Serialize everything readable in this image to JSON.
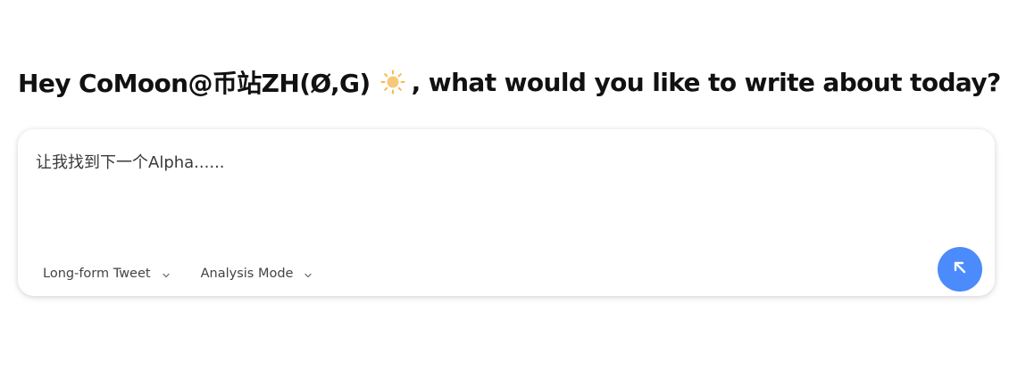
{
  "greeting": {
    "prefix": "Hey CoMoon@币站ZH(Ø,G)",
    "emoji_icon": "sun-icon",
    "suffix": ", what would you like to write about today?"
  },
  "composer": {
    "placeholder": "让我找到下一个Alpha......",
    "format_select": "Long-form Tweet",
    "mode_select": "Analysis Mode",
    "send_icon": "arrow-up-left-icon"
  },
  "colors": {
    "accent": "#4b8bfb",
    "sun": "#f6b94f"
  }
}
